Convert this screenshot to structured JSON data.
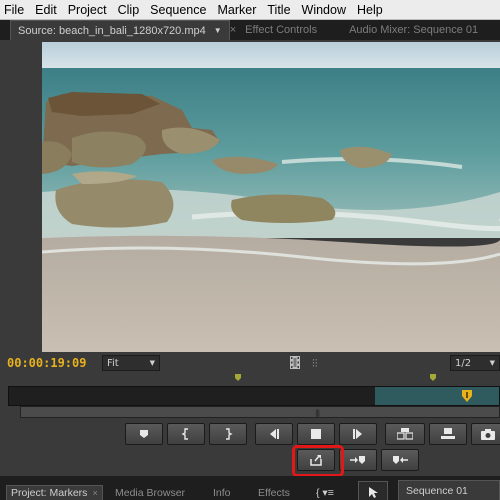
{
  "menu": [
    "File",
    "Edit",
    "Project",
    "Clip",
    "Sequence",
    "Marker",
    "Title",
    "Window",
    "Help"
  ],
  "tabs": {
    "source": "Source: beach_in_bali_1280x720.mp4",
    "effect_controls": "Effect Controls",
    "audio_mixer": "Audio Mixer: Sequence 01"
  },
  "monitor": {
    "timecode": "00:00:19:09",
    "zoom": "Fit",
    "resolution": "1/2",
    "accent_color": "#e8b21d",
    "highlight_color": "#e21717"
  },
  "transport": {
    "row1": [
      "marker-icon",
      "mark-in-icon",
      "mark-out-icon",
      "step-back-icon",
      "stop-icon",
      "play-icon",
      "export-frame-icon",
      "settings-icon",
      "camera-icon"
    ],
    "row2": [
      "loop-icon",
      "insert-icon",
      "overwrite-icon"
    ]
  },
  "bottom_tabs": {
    "project": "Project: Markers",
    "media_browser": "Media Browser",
    "info": "Info",
    "effects": "Effects",
    "sequence": "Sequence 01"
  }
}
